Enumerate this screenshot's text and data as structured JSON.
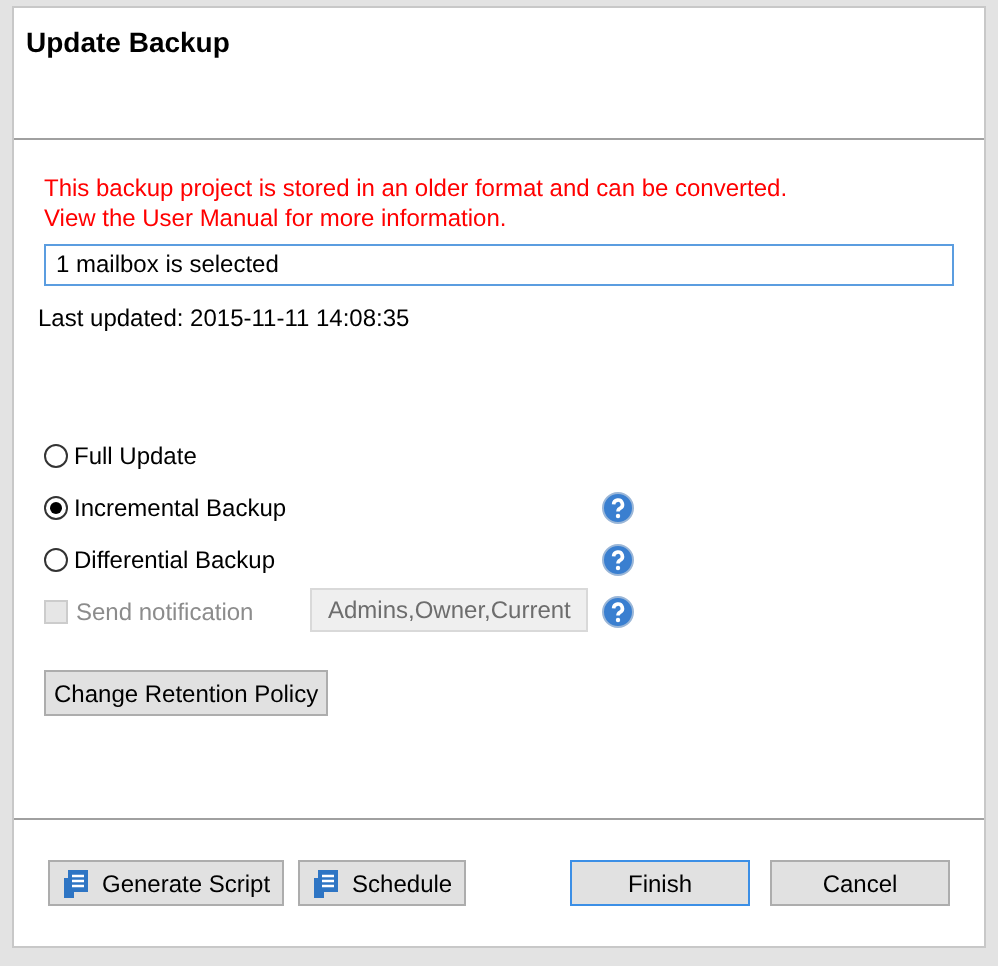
{
  "window": {
    "title": "Update Backup"
  },
  "warning": [
    "This backup project is stored in an older format and can be converted.",
    "View the User Manual for more information."
  ],
  "selection_field": {
    "value": "1 mailbox is selected"
  },
  "last_updated": "Last updated: 2015-11-11 14:08:35",
  "options": [
    {
      "kind": "radio",
      "label": "Full Update",
      "selected": false,
      "help": false
    },
    {
      "kind": "radio",
      "label": "Incremental Backup",
      "selected": true,
      "help": true
    },
    {
      "kind": "radio",
      "label": "Differential Backup",
      "selected": false,
      "help": true
    },
    {
      "kind": "checkbox",
      "label": "Send notification",
      "checked": false,
      "disabled": true,
      "recipients": "Admins,Owner,Current",
      "help": true
    }
  ],
  "retention_button": "Change Retention Policy",
  "footer_left": [
    {
      "label": "Generate Script"
    },
    {
      "label": "Schedule"
    }
  ],
  "footer_right": [
    {
      "label": "Finish",
      "default": true
    },
    {
      "label": "Cancel",
      "default": false
    }
  ]
}
